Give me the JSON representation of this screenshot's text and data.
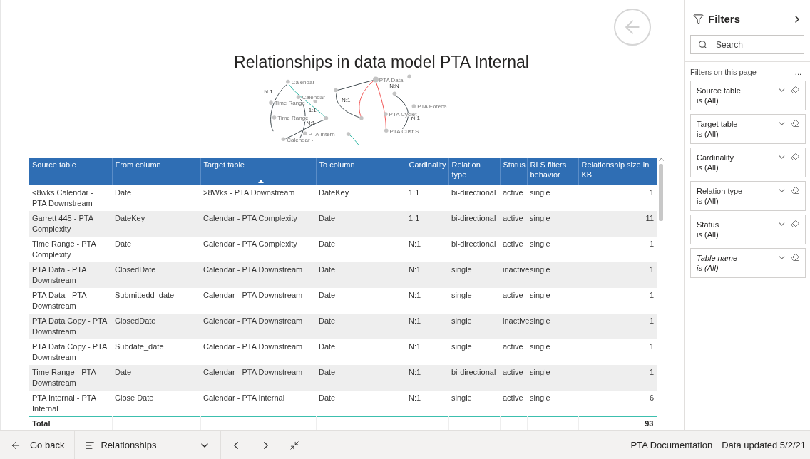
{
  "report": {
    "title": "Relationships in data model PTA Internal"
  },
  "graph": {
    "nodes": [
      {
        "label": "Calendar -"
      },
      {
        "label": "Calendar -"
      },
      {
        "label": "Time Range"
      },
      {
        "label": "Time Range"
      },
      {
        "label": "Calendar -"
      },
      {
        "label": "PTA Intern"
      },
      {
        "label": "PTA Data -"
      },
      {
        "label": "PTA Foreca"
      },
      {
        "label": "PTA Cyclet"
      },
      {
        "label": "PTA Cust S"
      }
    ],
    "edges": [
      {
        "label": "N:1"
      },
      {
        "label": "1:1"
      },
      {
        "label": "N:1"
      },
      {
        "label": "N:1"
      },
      {
        "label": "N:N"
      },
      {
        "label": "N:1"
      }
    ]
  },
  "table": {
    "columns": [
      {
        "label": "Source table",
        "sorted": false
      },
      {
        "label": "From column",
        "sorted": false
      },
      {
        "label": "Target table",
        "sorted": true
      },
      {
        "label": "To column",
        "sorted": false
      },
      {
        "label": "Cardinality",
        "sorted": false
      },
      {
        "label": "Relation type",
        "sorted": false
      },
      {
        "label": "Status",
        "sorted": false
      },
      {
        "label": "RLS filters behavior",
        "sorted": false
      },
      {
        "label": "Relationship size in KB",
        "sorted": false
      }
    ],
    "rows": [
      [
        "<8wks Calendar - PTA Downstream",
        "Date",
        ">8Wks - PTA Downstream",
        "DateKey",
        "1:1",
        "bi-directional",
        "active",
        "single",
        "1"
      ],
      [
        "Garrett 445 - PTA Complexity",
        "DateKey",
        "Calendar - PTA Complexity",
        "Date",
        "1:1",
        "bi-directional",
        "active",
        "single",
        "11"
      ],
      [
        "Time Range - PTA Complexity",
        "Date",
        "Calendar - PTA Complexity",
        "Date",
        "N:1",
        "bi-directional",
        "active",
        "single",
        "1"
      ],
      [
        "PTA Data - PTA Downstream",
        "ClosedDate",
        "Calendar - PTA Downstream",
        "Date",
        "N:1",
        "single",
        "inactive",
        "single",
        "1"
      ],
      [
        "PTA Data - PTA Downstream",
        "Submittedd_date",
        "Calendar - PTA Downstream",
        "Date",
        "N:1",
        "single",
        "active",
        "single",
        "1"
      ],
      [
        "PTA Data Copy - PTA Downstream",
        "ClosedDate",
        "Calendar - PTA Downstream",
        "Date",
        "N:1",
        "single",
        "inactive",
        "single",
        "1"
      ],
      [
        "PTA Data Copy - PTA Downstream",
        "Subdate_date",
        "Calendar - PTA Downstream",
        "Date",
        "N:1",
        "single",
        "active",
        "single",
        "1"
      ],
      [
        "Time Range - PTA Downstream",
        "Date",
        "Calendar - PTA Downstream",
        "Date",
        "N:1",
        "bi-directional",
        "active",
        "single",
        "1"
      ],
      [
        "PTA Internal - PTA Internal",
        "Close Date",
        "Calendar - PTA Internal",
        "Date",
        "N:1",
        "single",
        "active",
        "single",
        "6"
      ]
    ],
    "total": {
      "label": "Total",
      "value": "93"
    }
  },
  "filters": {
    "title": "Filters",
    "search": {
      "placeholder": "Search"
    },
    "section": "Filters on this page",
    "more": "...",
    "items": [
      {
        "name": "Source table",
        "value": "is (All)",
        "italic": false
      },
      {
        "name": "Target table",
        "value": "is (All)",
        "italic": false
      },
      {
        "name": "Cardinality",
        "value": "is (All)",
        "italic": false
      },
      {
        "name": "Relation type",
        "value": "is (All)",
        "italic": false
      },
      {
        "name": "Status",
        "value": "is (All)",
        "italic": false
      },
      {
        "name": "Table name",
        "value": "is (All)",
        "italic": true
      }
    ]
  },
  "bottom_bar": {
    "back": "Go back",
    "page": "Relationships",
    "report_name": "PTA Documentation",
    "updated": "Data updated 5/2/21"
  }
}
